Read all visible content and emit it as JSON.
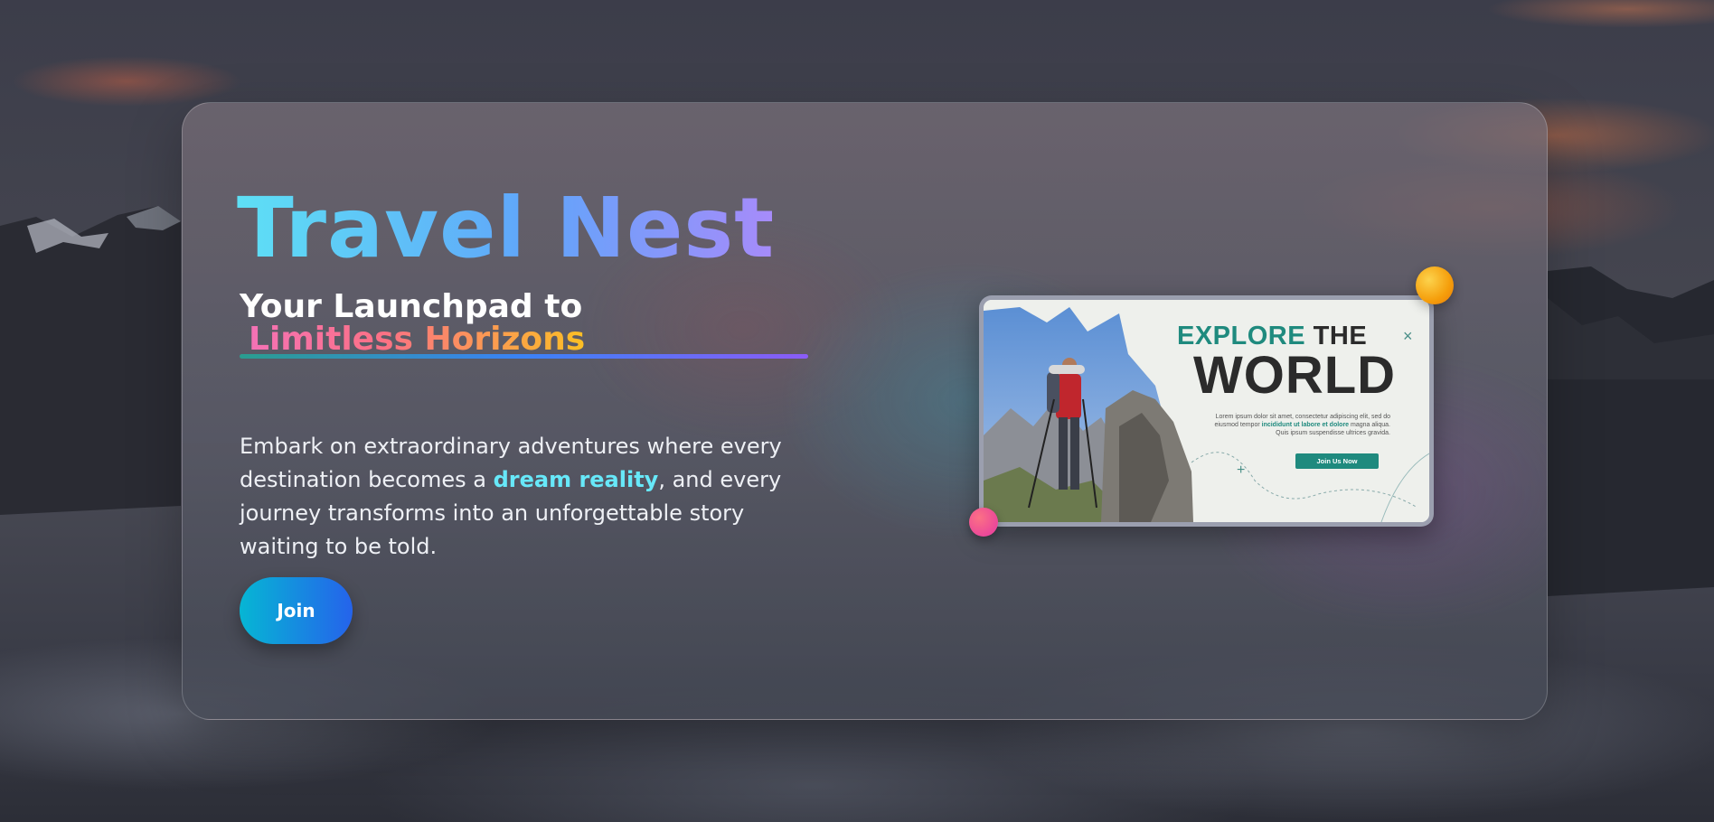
{
  "hero": {
    "title": "Travel Nest",
    "tagline_line1": "Your Launchpad to",
    "tagline_line2": "Limitless Horizons",
    "description_part1": "Embark on extraordinary adventures where every destination becomes a ",
    "description_highlight": "dream reality",
    "description_part2": ", and every journey transforms into an unforgettable story waiting to be told.",
    "join_label": "Join"
  },
  "preview": {
    "explore": "EXPLORE",
    "the": "THE",
    "world": "WORLD",
    "close_glyph": "×",
    "lorem_part1": "Lorem ipsum dolor sit amet, consectetur adipiscing elit, sed do eiusmod tempor ",
    "lorem_highlight": "incididunt ut labore et dolore",
    "lorem_part2": " magna aliqua. Quis ipsum suspendisse ultrices gravida.",
    "button_label": "Join Us Now",
    "plus_glyph": "+"
  },
  "colors": {
    "title_gradient": [
      "#5ee0f5",
      "#60a5fa",
      "#a78bfa"
    ],
    "tagline_gradient": [
      "#f472b6",
      "#fb7185",
      "#fbbf24"
    ],
    "highlight": "#67e8f9",
    "button_gradient": [
      "#06b6d4",
      "#2563eb"
    ],
    "preview_accent": "#1f8a7e"
  },
  "icons": {
    "close": "close-icon",
    "plus": "plus-icon"
  }
}
